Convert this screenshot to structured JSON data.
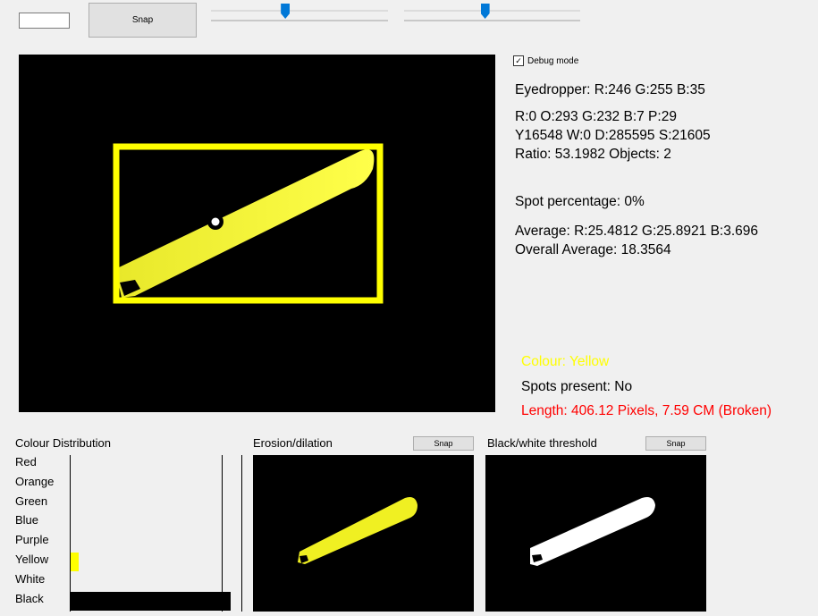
{
  "top": {
    "snap_label": "Snap",
    "slider1_value": 0.42,
    "slider2_value": 0.46
  },
  "debug": {
    "label": "Debug mode",
    "checked": true,
    "check_glyph": "✓"
  },
  "eyedropper": "Eyedropper: R:246 G:255 B:35",
  "stats": {
    "line1": "R:0 O:293 G:232 B:7 P:29",
    "line2": "Y16548 W:0 D:285595 S:21605",
    "line3": "Ratio: 53.1982 Objects: 2"
  },
  "spot_percentage": "Spot percentage: 0%",
  "average": "Average: R:25.4812 G:25.8921 B:3.696",
  "overall_average": "Overall Average: 18.3564",
  "result": {
    "colour": "Colour: Yellow",
    "spots": "Spots present: No",
    "length": "Length: 406.12 Pixels, 7.59 CM (Broken)"
  },
  "colour_distribution": {
    "title": "Colour Distribution",
    "items": [
      {
        "label": "Red",
        "value": 0,
        "color": "#ff0000"
      },
      {
        "label": "Orange",
        "value": 0,
        "color": "#ff8c00"
      },
      {
        "label": "Green",
        "value": 0,
        "color": "#00c000"
      },
      {
        "label": "Blue",
        "value": 0,
        "color": "#0000ff"
      },
      {
        "label": "Purple",
        "value": 0,
        "color": "#800080"
      },
      {
        "label": "Yellow",
        "value": 0.058,
        "color": "#ffff00"
      },
      {
        "label": "White",
        "value": 0,
        "color": "#ffffff"
      },
      {
        "label": "Black",
        "value": 1.0,
        "color": "#000000"
      }
    ]
  },
  "erosion": {
    "title": "Erosion/dilation",
    "snap_label": "Snap"
  },
  "threshold": {
    "title": "Black/white threshold",
    "snap_label": "Snap"
  },
  "colors": {
    "accent": "#0078d7",
    "detect_box": "#ffff00",
    "object": "#f2f22a"
  }
}
